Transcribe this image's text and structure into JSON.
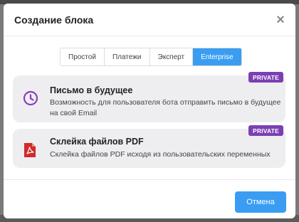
{
  "dialog": {
    "title": "Создание блока",
    "close_symbol": "×"
  },
  "tabs": [
    {
      "label": "Простой",
      "active": false
    },
    {
      "label": "Платежи",
      "active": false
    },
    {
      "label": "Эксперт",
      "active": false
    },
    {
      "label": "Enterprise",
      "active": true
    }
  ],
  "blocks": [
    {
      "icon": "clock-icon",
      "title": "Письмо в будущее",
      "description": "Возможность для пользователя бота отправить письмо в будущее на свой Email",
      "badge": "PRIVATE"
    },
    {
      "icon": "pdf-file-icon",
      "title": "Склейка файлов PDF",
      "description": "Склейка файлов PDF исходя из пользовательских переменных",
      "badge": "PRIVATE"
    }
  ],
  "footer": {
    "cancel_label": "Отмена"
  },
  "colors": {
    "accent": "#3a9df2",
    "badge": "#7b3fb2",
    "clock_icon": "#8a3fb8",
    "pdf_icon": "#d12a2a"
  }
}
